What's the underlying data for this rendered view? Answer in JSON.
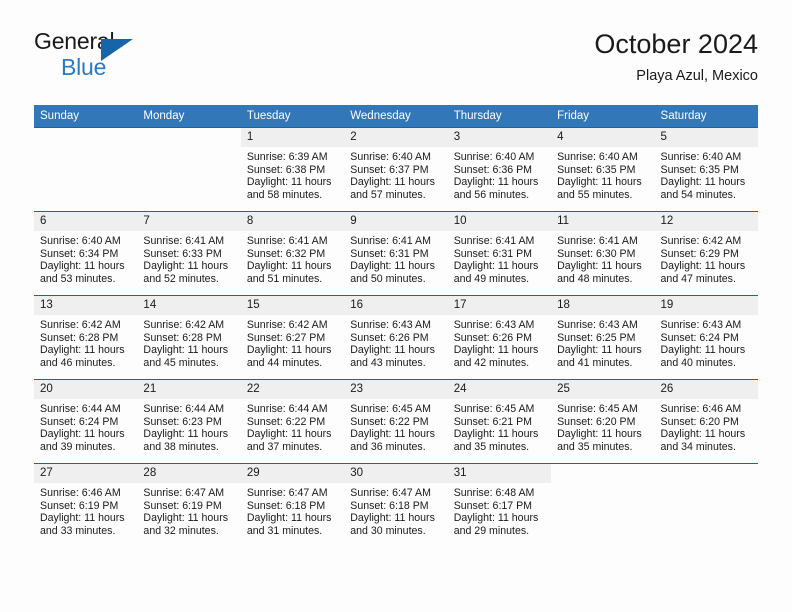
{
  "brand": {
    "line1": "General",
    "line2": "Blue",
    "triangle_icon": "brand-triangle-icon",
    "colors": {
      "blue": "#2a7ac4",
      "dark_blue": "#1565a8",
      "black": "#1a1a1a"
    }
  },
  "header": {
    "title": "October 2024",
    "subtitle": "Playa Azul, Mexico"
  },
  "calendar": {
    "header_bg": "#3277b8",
    "daynum_bg": "#efefef",
    "border_color": "#1565a8",
    "weekday_headers": [
      "Sunday",
      "Monday",
      "Tuesday",
      "Wednesday",
      "Thursday",
      "Friday",
      "Saturday"
    ],
    "weeks": [
      [
        {
          "day": "",
          "lines": []
        },
        {
          "day": "",
          "lines": []
        },
        {
          "day": "1",
          "lines": [
            "Sunrise: 6:39 AM",
            "Sunset: 6:38 PM",
            "Daylight: 11 hours and 58 minutes."
          ]
        },
        {
          "day": "2",
          "lines": [
            "Sunrise: 6:40 AM",
            "Sunset: 6:37 PM",
            "Daylight: 11 hours and 57 minutes."
          ]
        },
        {
          "day": "3",
          "lines": [
            "Sunrise: 6:40 AM",
            "Sunset: 6:36 PM",
            "Daylight: 11 hours and 56 minutes."
          ]
        },
        {
          "day": "4",
          "lines": [
            "Sunrise: 6:40 AM",
            "Sunset: 6:35 PM",
            "Daylight: 11 hours and 55 minutes."
          ]
        },
        {
          "day": "5",
          "lines": [
            "Sunrise: 6:40 AM",
            "Sunset: 6:35 PM",
            "Daylight: 11 hours and 54 minutes."
          ]
        }
      ],
      [
        {
          "day": "6",
          "lines": [
            "Sunrise: 6:40 AM",
            "Sunset: 6:34 PM",
            "Daylight: 11 hours and 53 minutes."
          ]
        },
        {
          "day": "7",
          "lines": [
            "Sunrise: 6:41 AM",
            "Sunset: 6:33 PM",
            "Daylight: 11 hours and 52 minutes."
          ]
        },
        {
          "day": "8",
          "lines": [
            "Sunrise: 6:41 AM",
            "Sunset: 6:32 PM",
            "Daylight: 11 hours and 51 minutes."
          ]
        },
        {
          "day": "9",
          "lines": [
            "Sunrise: 6:41 AM",
            "Sunset: 6:31 PM",
            "Daylight: 11 hours and 50 minutes."
          ]
        },
        {
          "day": "10",
          "lines": [
            "Sunrise: 6:41 AM",
            "Sunset: 6:31 PM",
            "Daylight: 11 hours and 49 minutes."
          ]
        },
        {
          "day": "11",
          "lines": [
            "Sunrise: 6:41 AM",
            "Sunset: 6:30 PM",
            "Daylight: 11 hours and 48 minutes."
          ]
        },
        {
          "day": "12",
          "lines": [
            "Sunrise: 6:42 AM",
            "Sunset: 6:29 PM",
            "Daylight: 11 hours and 47 minutes."
          ]
        }
      ],
      [
        {
          "day": "13",
          "lines": [
            "Sunrise: 6:42 AM",
            "Sunset: 6:28 PM",
            "Daylight: 11 hours and 46 minutes."
          ]
        },
        {
          "day": "14",
          "lines": [
            "Sunrise: 6:42 AM",
            "Sunset: 6:28 PM",
            "Daylight: 11 hours and 45 minutes."
          ]
        },
        {
          "day": "15",
          "lines": [
            "Sunrise: 6:42 AM",
            "Sunset: 6:27 PM",
            "Daylight: 11 hours and 44 minutes."
          ]
        },
        {
          "day": "16",
          "lines": [
            "Sunrise: 6:43 AM",
            "Sunset: 6:26 PM",
            "Daylight: 11 hours and 43 minutes."
          ]
        },
        {
          "day": "17",
          "lines": [
            "Sunrise: 6:43 AM",
            "Sunset: 6:26 PM",
            "Daylight: 11 hours and 42 minutes."
          ]
        },
        {
          "day": "18",
          "lines": [
            "Sunrise: 6:43 AM",
            "Sunset: 6:25 PM",
            "Daylight: 11 hours and 41 minutes."
          ]
        },
        {
          "day": "19",
          "lines": [
            "Sunrise: 6:43 AM",
            "Sunset: 6:24 PM",
            "Daylight: 11 hours and 40 minutes."
          ]
        }
      ],
      [
        {
          "day": "20",
          "lines": [
            "Sunrise: 6:44 AM",
            "Sunset: 6:24 PM",
            "Daylight: 11 hours and 39 minutes."
          ]
        },
        {
          "day": "21",
          "lines": [
            "Sunrise: 6:44 AM",
            "Sunset: 6:23 PM",
            "Daylight: 11 hours and 38 minutes."
          ]
        },
        {
          "day": "22",
          "lines": [
            "Sunrise: 6:44 AM",
            "Sunset: 6:22 PM",
            "Daylight: 11 hours and 37 minutes."
          ]
        },
        {
          "day": "23",
          "lines": [
            "Sunrise: 6:45 AM",
            "Sunset: 6:22 PM",
            "Daylight: 11 hours and 36 minutes."
          ]
        },
        {
          "day": "24",
          "lines": [
            "Sunrise: 6:45 AM",
            "Sunset: 6:21 PM",
            "Daylight: 11 hours and 35 minutes."
          ]
        },
        {
          "day": "25",
          "lines": [
            "Sunrise: 6:45 AM",
            "Sunset: 6:20 PM",
            "Daylight: 11 hours and 35 minutes."
          ]
        },
        {
          "day": "26",
          "lines": [
            "Sunrise: 6:46 AM",
            "Sunset: 6:20 PM",
            "Daylight: 11 hours and 34 minutes."
          ]
        }
      ],
      [
        {
          "day": "27",
          "lines": [
            "Sunrise: 6:46 AM",
            "Sunset: 6:19 PM",
            "Daylight: 11 hours and 33 minutes."
          ]
        },
        {
          "day": "28",
          "lines": [
            "Sunrise: 6:47 AM",
            "Sunset: 6:19 PM",
            "Daylight: 11 hours and 32 minutes."
          ]
        },
        {
          "day": "29",
          "lines": [
            "Sunrise: 6:47 AM",
            "Sunset: 6:18 PM",
            "Daylight: 11 hours and 31 minutes."
          ]
        },
        {
          "day": "30",
          "lines": [
            "Sunrise: 6:47 AM",
            "Sunset: 6:18 PM",
            "Daylight: 11 hours and 30 minutes."
          ]
        },
        {
          "day": "31",
          "lines": [
            "Sunrise: 6:48 AM",
            "Sunset: 6:17 PM",
            "Daylight: 11 hours and 29 minutes."
          ]
        },
        {
          "day": "",
          "lines": []
        },
        {
          "day": "",
          "lines": []
        }
      ]
    ]
  }
}
